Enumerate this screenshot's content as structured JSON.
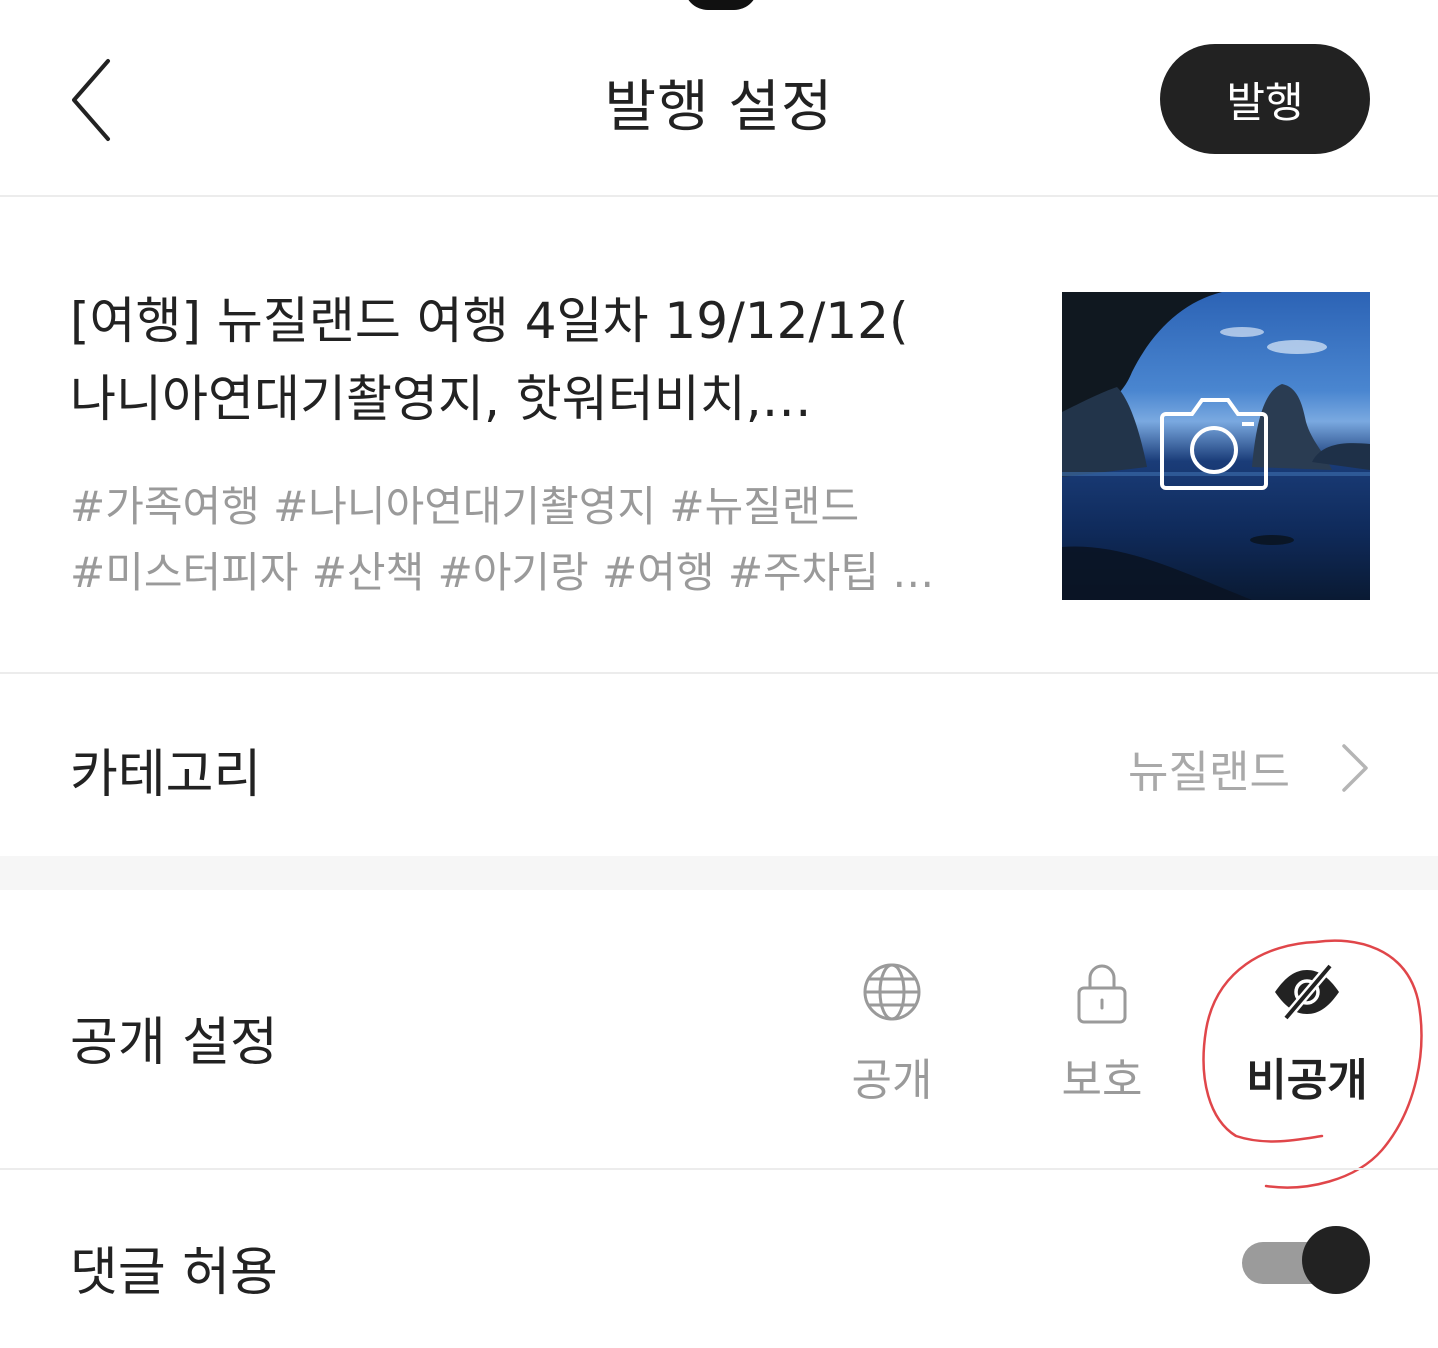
{
  "header": {
    "title": "발행 설정",
    "publish_label": "발행"
  },
  "post": {
    "title_line1": "[여행] 뉴질랜드 여행 4일차 19/12/12(",
    "title_line2": "나니아연대기촬영지, 핫워터비치,…",
    "tags_line1": "#가족여행  #나니아연대기촬영지  #뉴질랜드",
    "tags_line2": "#미스터피자  #산책  #아기랑  #여행  #주차팁 …",
    "thumbnail_icon": "camera-icon"
  },
  "category": {
    "label": "카테고리",
    "value": "뉴질랜드"
  },
  "visibility": {
    "label": "공개 설정",
    "options": [
      {
        "label": "공개",
        "icon": "globe-icon",
        "selected": false
      },
      {
        "label": "보호",
        "icon": "lock-icon",
        "selected": false
      },
      {
        "label": "비공개",
        "icon": "eye-off-icon",
        "selected": true
      }
    ]
  },
  "comments": {
    "label": "댓글 허용",
    "enabled": true
  },
  "colors": {
    "primary": "#222222",
    "muted": "#9a9a9a",
    "annotation": "#e0464a"
  }
}
